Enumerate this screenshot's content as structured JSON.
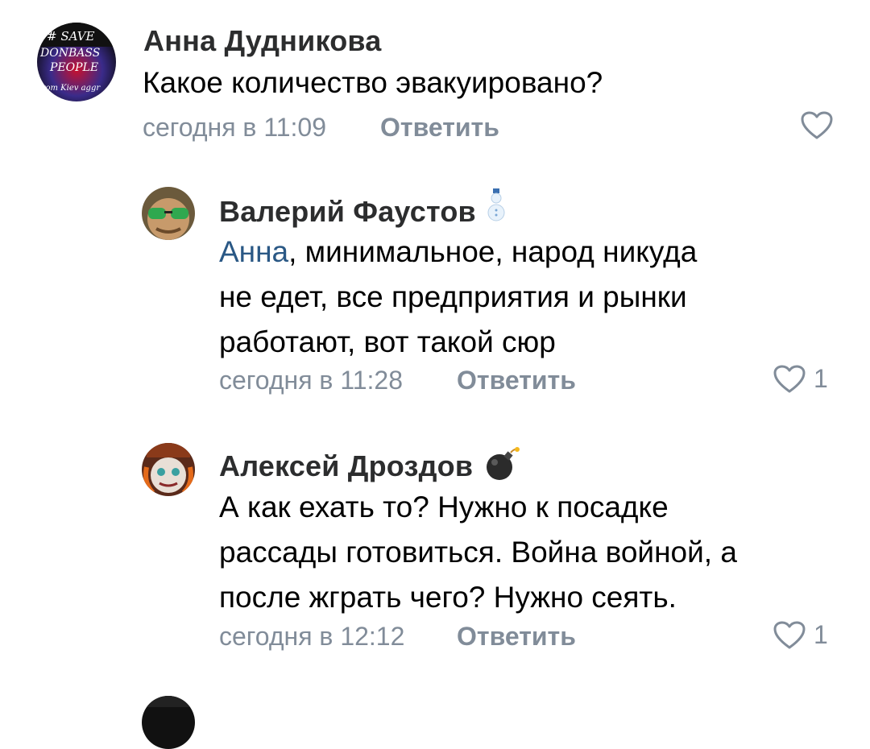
{
  "comments": [
    {
      "author": "Анна Дудникова",
      "avatar_text": [
        "# SAVE",
        "DONBASS",
        "PEOPLE",
        "from Kiev aggr"
      ],
      "text_lines": [
        "Какое количество эвакуировано?"
      ],
      "time": "сегодня в 11:09",
      "reply_label": "Ответить",
      "likes": ""
    },
    {
      "author": "Валерий Фаустов",
      "badge_icon": "snowman-icon",
      "mention": "Анна",
      "text_lines": [
        ", минимальное, народ никуда",
        "не едет, все предприятия и рынки",
        "работают, вот такой сюр"
      ],
      "time": "сегодня в 11:28",
      "reply_label": "Ответить",
      "likes": "1"
    },
    {
      "author": "Алексей Дроздов",
      "badge_icon": "bomb-icon",
      "text_lines": [
        "А как ехать то? Нужно к посадке",
        "рассады готовиться. Война войной, а",
        "после жграть чего? Нужно сеять."
      ],
      "time": "сегодня в 12:12",
      "reply_label": "Ответить",
      "likes": "1"
    }
  ],
  "colors": {
    "link": "#2a5885",
    "secondary": "#818c99",
    "name": "#2c2d2e"
  }
}
